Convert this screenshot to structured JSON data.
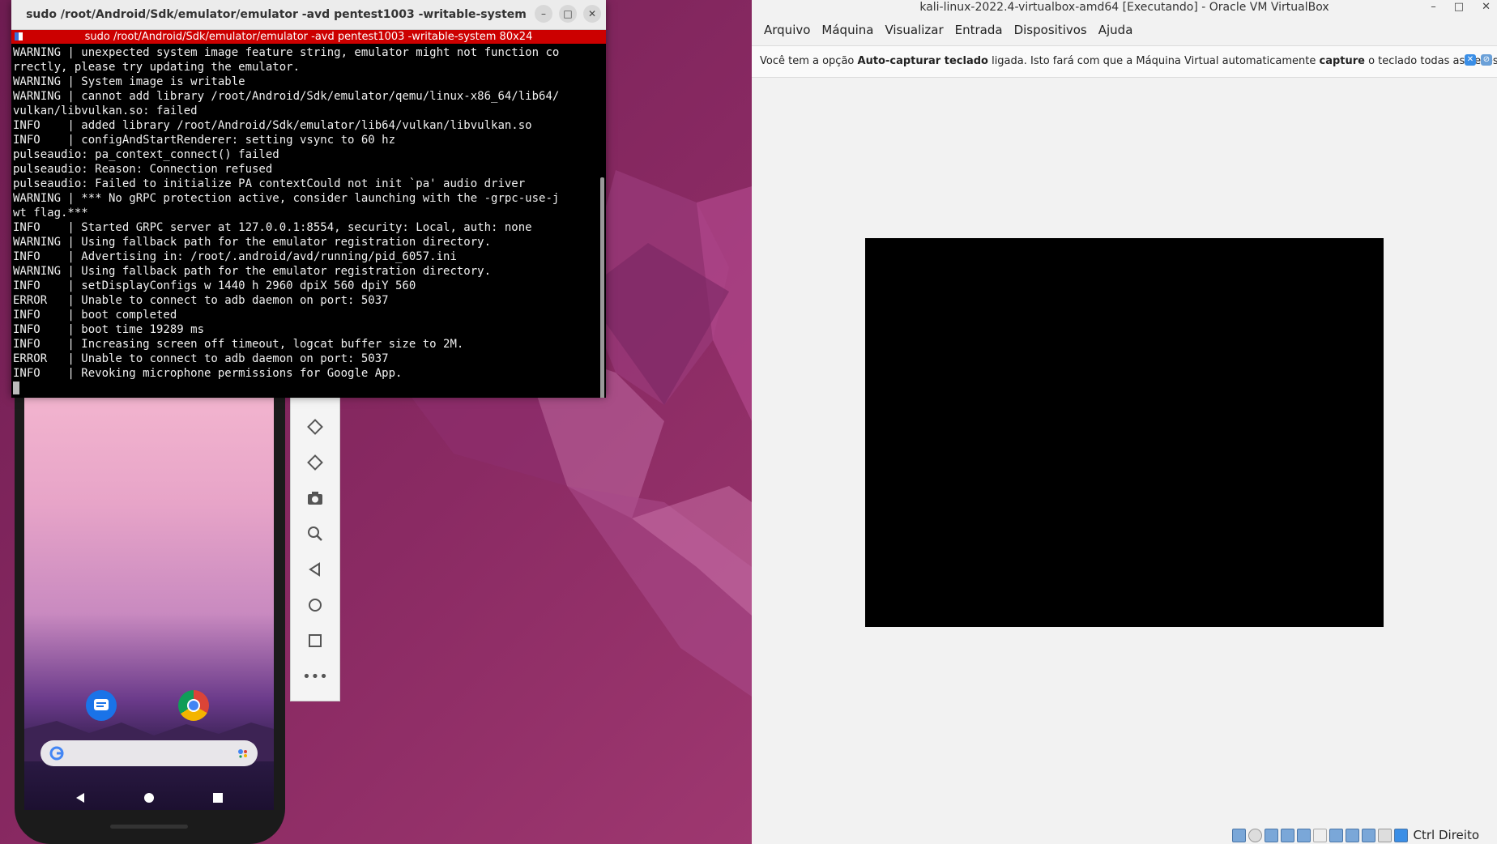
{
  "terminal": {
    "title": "sudo /root/Android/Sdk/emulator/emulator -avd pentest1003 -writable-system",
    "tab_label": "sudo /root/Android/Sdk/emulator/emulator -avd pentest1003 -writable-system   80x24",
    "lines": [
      "WARNING | unexpected system image feature string, emulator might not function co",
      "rrectly, please try updating the emulator.",
      "WARNING | System image is writable",
      "WARNING | cannot add library /root/Android/Sdk/emulator/qemu/linux-x86_64/lib64/",
      "vulkan/libvulkan.so: failed",
      "INFO    | added library /root/Android/Sdk/emulator/lib64/vulkan/libvulkan.so",
      "INFO    | configAndStartRenderer: setting vsync to 60 hz",
      "pulseaudio: pa_context_connect() failed",
      "pulseaudio: Reason: Connection refused",
      "pulseaudio: Failed to initialize PA contextCould not init `pa' audio driver",
      "WARNING | *** No gRPC protection active, consider launching with the -grpc-use-j",
      "wt flag.***",
      "INFO    | Started GRPC server at 127.0.0.1:8554, security: Local, auth: none",
      "WARNING | Using fallback path for the emulator registration directory.",
      "INFO    | Advertising in: /root/.android/avd/running/pid_6057.ini",
      "WARNING | Using fallback path for the emulator registration directory.",
      "INFO    | setDisplayConfigs w 1440 h 2960 dpiX 560 dpiY 560",
      "ERROR   | Unable to connect to adb daemon on port: 5037",
      "INFO    | boot completed",
      "INFO    | boot time 19289 ms",
      "INFO    | Increasing screen off timeout, logcat buffer size to 2M.",
      "ERROR   | Unable to connect to adb daemon on port: 5037",
      "INFO    | Revoking microphone permissions for Google App."
    ],
    "buttons": {
      "minimize": "–",
      "maximize": "□",
      "close": "✕"
    }
  },
  "emulator_toolbar": {
    "icons": [
      "rotate-left-icon",
      "rotate-right-icon",
      "camera-icon",
      "zoom-icon",
      "back-icon",
      "home-icon",
      "overview-icon",
      "more-icon"
    ],
    "more_label": "•••"
  },
  "vbox": {
    "title": "kali-linux-2022.4-virtualbox-amd64 [Executando] - Oracle VM VirtualBox",
    "title_buttons": {
      "minimize": "–",
      "maximize": "□",
      "close": "✕"
    },
    "menu": [
      "Arquivo",
      "Máquina",
      "Visualizar",
      "Entrada",
      "Dispositivos",
      "Ajuda"
    ],
    "notice_prefix": "Você tem a opção ",
    "notice_bold1": "Auto-capturar teclado",
    "notice_mid": " ligada. Isto fará com que a Máquina Virtual automaticamente ",
    "notice_bold2": "capture",
    "notice_suffix": " o teclado todas as vezes em que a",
    "host_key": "Ctrl Direito"
  },
  "colors": {
    "terminal_tab": "#cc0000",
    "wallpaper": "#8a2a63"
  }
}
